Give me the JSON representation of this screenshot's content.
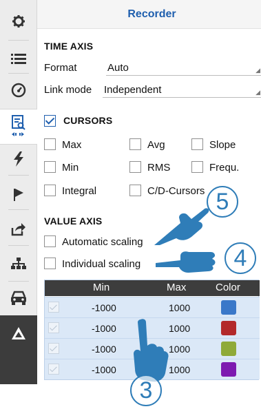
{
  "sidebar": {
    "items": [
      {
        "icon": "gear-icon",
        "active": false
      },
      {
        "icon": "list-icon",
        "active": false
      },
      {
        "icon": "gauge-icon",
        "active": false
      },
      {
        "icon": "recorder-icon",
        "active": true
      },
      {
        "icon": "lightning-icon",
        "active": false
      },
      {
        "icon": "flag-icon",
        "active": false
      },
      {
        "icon": "export-icon",
        "active": false
      },
      {
        "icon": "network-icon",
        "active": false
      },
      {
        "icon": "car-icon",
        "active": false
      },
      {
        "icon": "logo-icon",
        "active": false
      }
    ]
  },
  "panel": {
    "title": "Recorder"
  },
  "time_axis": {
    "section_label": "TIME AXIS",
    "format_label": "Format",
    "format_value": "Auto",
    "link_mode_label": "Link mode",
    "link_mode_value": "Independent"
  },
  "cursors": {
    "section_label": "CURSORS",
    "checked": true,
    "options": {
      "max": {
        "label": "Max",
        "checked": false
      },
      "avg": {
        "label": "Avg",
        "checked": false
      },
      "slope": {
        "label": "Slope",
        "checked": false
      },
      "min": {
        "label": "Min",
        "checked": false
      },
      "rms": {
        "label": "RMS",
        "checked": false
      },
      "frequ": {
        "label": "Frequ.",
        "checked": false
      },
      "integral": {
        "label": "Integral",
        "checked": false
      },
      "cd_cursors": {
        "label": "C/D-Cursors",
        "checked": false
      }
    }
  },
  "value_axis": {
    "section_label": "VALUE AXIS",
    "automatic_scaling": {
      "label": "Automatic scaling",
      "checked": false
    },
    "individual_scaling": {
      "label": "Individual scaling",
      "checked": false
    }
  },
  "grid": {
    "headers": {
      "min": "Min",
      "max": "Max",
      "color": "Color"
    },
    "rows": [
      {
        "min": "-1000",
        "max": "1000",
        "color": "#3a78c9"
      },
      {
        "min": "-1000",
        "max": "1000",
        "color": "#b3292b"
      },
      {
        "min": "-1000",
        "max": "1000",
        "color": "#8faa38"
      },
      {
        "min": "-1000",
        "max": "1000",
        "color": "#7d1ab0"
      }
    ]
  },
  "callouts": {
    "c3": "3",
    "c4": "4",
    "c5": "5"
  },
  "colors": {
    "accent": "#1f5fae",
    "hand": "#2f7db8"
  }
}
